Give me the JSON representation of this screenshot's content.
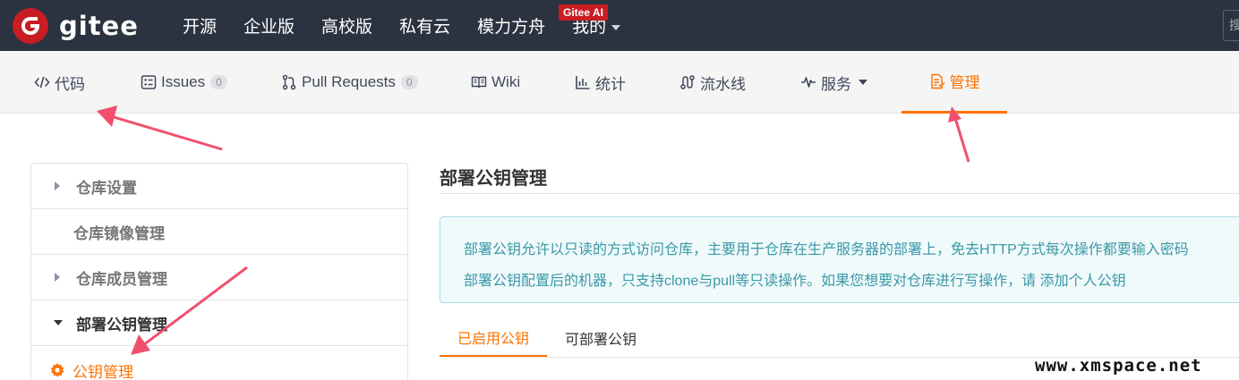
{
  "brand": {
    "name": "gitee"
  },
  "topnav": {
    "items": [
      "开源",
      "企业版",
      "高校版",
      "私有云",
      "模力方舟",
      "我的"
    ],
    "ai_badge": "Gitee AI",
    "search_placeholder": "搜"
  },
  "tabs": [
    {
      "label": "代码",
      "icon": "code-icon"
    },
    {
      "label": "Issues",
      "count": "0",
      "icon": "issues-icon"
    },
    {
      "label": "Pull Requests",
      "count": "0",
      "icon": "pull-request-icon"
    },
    {
      "label": "Wiki",
      "icon": "book-icon"
    },
    {
      "label": "统计",
      "icon": "bar-chart-icon"
    },
    {
      "label": "流水线",
      "icon": "pipeline-icon"
    },
    {
      "label": "服务",
      "icon": "pulse-icon"
    },
    {
      "label": "管理",
      "icon": "manage-icon",
      "active": true
    }
  ],
  "sidebar": {
    "items": [
      {
        "label": "仓库设置"
      },
      {
        "label": "仓库镜像管理"
      },
      {
        "label": "仓库成员管理"
      },
      {
        "label": "部署公钥管理"
      }
    ],
    "sub_active": "公钥管理"
  },
  "main": {
    "title": "部署公钥管理",
    "info_line1": "部署公钥允许以只读的方式访问仓库，主要用于仓库在生产服务器的部署上，免去HTTP方式每次操作都要输入密码",
    "info_line2_prefix": "部署公钥配置后的机器，只支持clone与pull等只读操作。如果您想要对仓库进行写操作，请 ",
    "info_link": "添加个人公钥",
    "subtabs": [
      "已启用公钥",
      "可部署公钥"
    ]
  },
  "watermark": "www.xmspace.net",
  "colors": {
    "accent": "#fe7300",
    "topbar": "#2b3240",
    "brand_red": "#c71d23",
    "info_text": "#3a98a7",
    "arrow": "#f0506e"
  }
}
